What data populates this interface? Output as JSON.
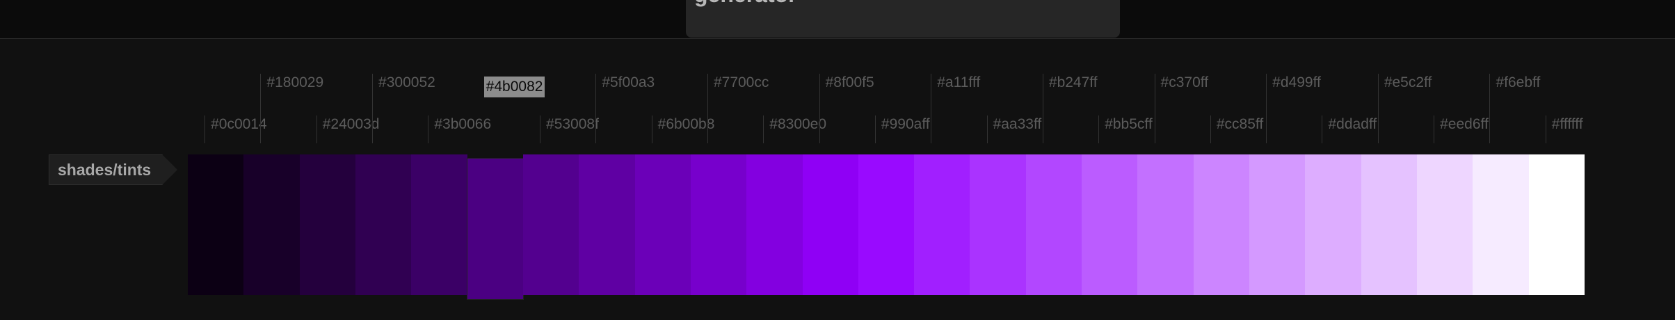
{
  "header": {
    "title": "generator"
  },
  "row": {
    "label": "shades/tints"
  },
  "palette": {
    "selected_index": 5,
    "colors": [
      "#0c0014",
      "#180029",
      "#24003d",
      "#300052",
      "#3b0066",
      "#4b0082",
      "#53008f",
      "#5f00a3",
      "#6b00b8",
      "#7700cc",
      "#8300e0",
      "#8f00f5",
      "#990aff",
      "#a11fff",
      "#aa33ff",
      "#b247ff",
      "#bb5cff",
      "#c370ff",
      "#cc85ff",
      "#d499ff",
      "#ddadff",
      "#e5c2ff",
      "#eed6ff",
      "#f6ebff",
      "#ffffff"
    ],
    "labels": [
      "#0c0014",
      "#180029",
      "#24003d",
      "#300052",
      "#3b0066",
      "#4b0082",
      "#53008f",
      "#5f00a3",
      "#6b00b8",
      "#7700cc",
      "#8300e0",
      "#8f00f5",
      "#990aff",
      "#a11fff",
      "#aa33ff",
      "#b247ff",
      "#bb5cff",
      "#c370ff",
      "#cc85ff",
      "#d499ff",
      "#ddadff",
      "#e5c2ff",
      "#eed6ff",
      "#f6ebff",
      "#ffffff"
    ]
  }
}
